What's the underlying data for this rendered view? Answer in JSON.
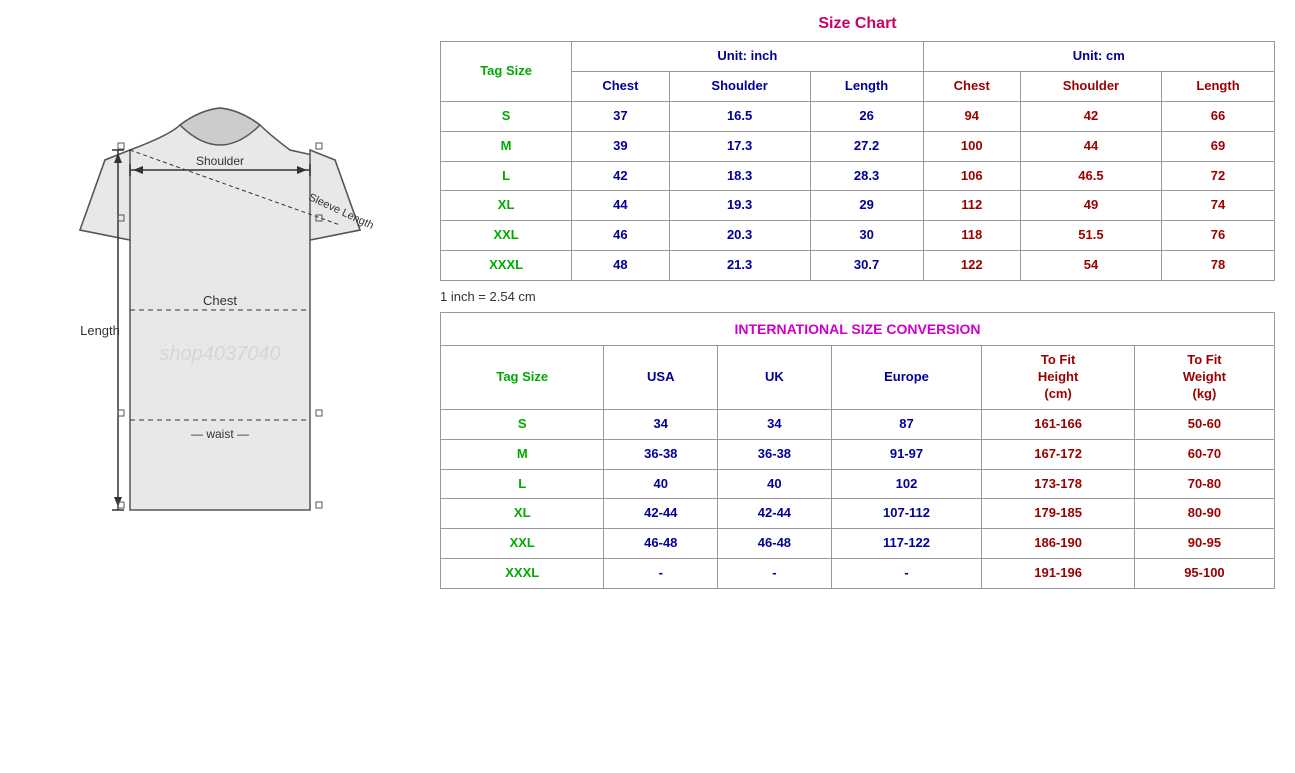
{
  "page": {
    "title": "Size Chart"
  },
  "size_chart": {
    "title": "Size Chart",
    "note": "1 inch = 2.54 cm",
    "unit_inch": "Unit: inch",
    "unit_cm": "Unit: cm",
    "tag_size_label": "Tag Size",
    "headers_inch": [
      "Chest",
      "Shoulder",
      "Length"
    ],
    "headers_cm": [
      "Chest",
      "Shoulder",
      "Length"
    ],
    "rows": [
      {
        "tag": "S",
        "chest_in": "37",
        "shoulder_in": "16.5",
        "length_in": "26",
        "chest_cm": "94",
        "shoulder_cm": "42",
        "length_cm": "66"
      },
      {
        "tag": "M",
        "chest_in": "39",
        "shoulder_in": "17.3",
        "length_in": "27.2",
        "chest_cm": "100",
        "shoulder_cm": "44",
        "length_cm": "69"
      },
      {
        "tag": "L",
        "chest_in": "42",
        "shoulder_in": "18.3",
        "length_in": "28.3",
        "chest_cm": "106",
        "shoulder_cm": "46.5",
        "length_cm": "72"
      },
      {
        "tag": "XL",
        "chest_in": "44",
        "shoulder_in": "19.3",
        "length_in": "29",
        "chest_cm": "112",
        "shoulder_cm": "49",
        "length_cm": "74"
      },
      {
        "tag": "XXL",
        "chest_in": "46",
        "shoulder_in": "20.3",
        "length_in": "30",
        "chest_cm": "118",
        "shoulder_cm": "51.5",
        "length_cm": "76"
      },
      {
        "tag": "XXXL",
        "chest_in": "48",
        "shoulder_in": "21.3",
        "length_in": "30.7",
        "chest_cm": "122",
        "shoulder_cm": "54",
        "length_cm": "78"
      }
    ]
  },
  "conversion": {
    "title": "INTERNATIONAL SIZE CONVERSION",
    "tag_size_label": "Tag Size",
    "headers": [
      "USA",
      "UK",
      "Europe",
      "To Fit Height (cm)",
      "To Fit Weight (kg)"
    ],
    "rows": [
      {
        "tag": "S",
        "usa": "34",
        "uk": "34",
        "europe": "87",
        "height": "161-166",
        "weight": "50-60"
      },
      {
        "tag": "M",
        "usa": "36-38",
        "uk": "36-38",
        "europe": "91-97",
        "height": "167-172",
        "weight": "60-70"
      },
      {
        "tag": "L",
        "usa": "40",
        "uk": "40",
        "europe": "102",
        "height": "173-178",
        "weight": "70-80"
      },
      {
        "tag": "XL",
        "usa": "42-44",
        "uk": "42-44",
        "europe": "107-112",
        "height": "179-185",
        "weight": "80-90"
      },
      {
        "tag": "XXL",
        "usa": "46-48",
        "uk": "46-48",
        "europe": "117-122",
        "height": "186-190",
        "weight": "90-95"
      },
      {
        "tag": "XXXL",
        "usa": "-",
        "uk": "-",
        "europe": "-",
        "height": "191-196",
        "weight": "95-100"
      }
    ]
  },
  "diagram": {
    "labels": {
      "shoulder": "Shoulder",
      "sleeve_length": "Sleeve Length",
      "chest": "Chest",
      "length": "Length",
      "waist": "waist"
    }
  },
  "watermark": "shop4037040"
}
